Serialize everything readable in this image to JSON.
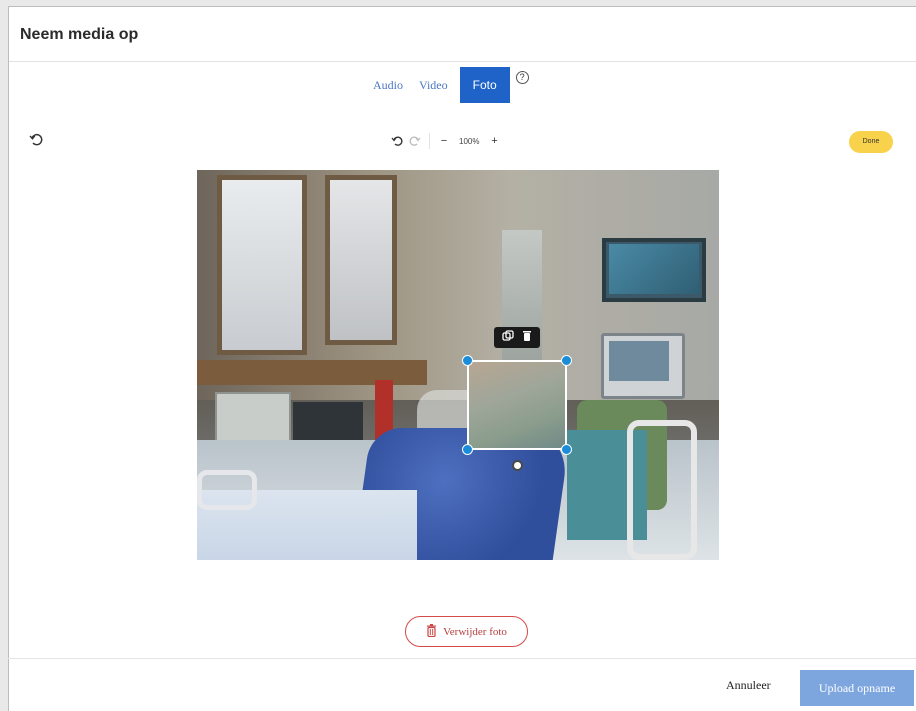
{
  "modal": {
    "title": "Neem media op"
  },
  "tabs": [
    {
      "label": "Audio",
      "active": false
    },
    {
      "label": "Video",
      "active": false
    },
    {
      "label": "Foto",
      "active": true
    }
  ],
  "help": {
    "symbol": "?"
  },
  "toolbar": {
    "zoom": "100%",
    "zoom_out_label": "−",
    "zoom_in_label": "+",
    "done_label": "Done"
  },
  "editor": {
    "icons": [
      "reset-icon",
      "undo-icon",
      "redo-icon",
      "duplicate-icon",
      "trash-icon"
    ]
  },
  "delete_photo": {
    "label": "Verwijder foto"
  },
  "footer": {
    "cancel_label": "Annuleer",
    "upload_label": "Upload opname"
  },
  "colors": {
    "accent": "#1f63c9",
    "done": "#f7d24a",
    "danger": "#d54b4b",
    "upload": "#7ea6de",
    "handle": "#1a8cd8"
  }
}
